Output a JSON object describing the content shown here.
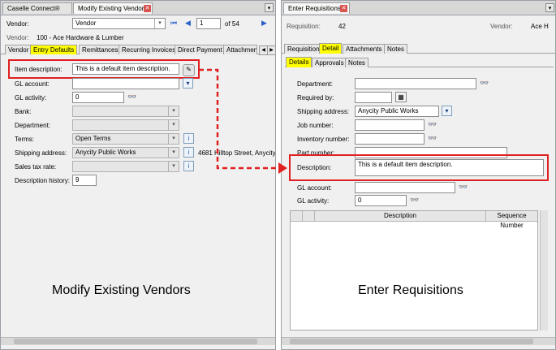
{
  "left": {
    "tabs": [
      {
        "label": "Caselle Connect®"
      },
      {
        "label": "Modify Existing Vendors"
      }
    ],
    "vendor_label": "Vendor:",
    "vendor_search_value": "Vendor",
    "record_number": "1",
    "record_total": "of 54",
    "vendor_info_label": "Vendor:",
    "vendor_info_value": "100  -  Ace Hardware & Lumber",
    "sub_tabs": [
      "Vendor",
      "Entry Defaults",
      "Remittances",
      "Recurring Invoices",
      "Direct Payment",
      "Attachmen"
    ],
    "form": {
      "item_description_label": "Item description:",
      "item_description_value": "This is a default item description.",
      "gl_account_label": "GL account:",
      "gl_activity_label": "GL activity:",
      "gl_activity_value": "0",
      "bank_label": "Bank:",
      "department_label": "Department:",
      "terms_label": "Terms:",
      "terms_value": "Open Terms",
      "shipping_address_label": "Shipping address:",
      "shipping_address_value": "Anycity Public Works",
      "shipping_address_extra": "4681 Hilltop Street, Anycity",
      "sales_tax_rate_label": "Sales tax rate:",
      "description_history_label": "Description history:",
      "description_history_value": "9"
    },
    "caption": "Modify Existing Vendors"
  },
  "right": {
    "tabs": [
      {
        "label": "Enter Requisitions"
      }
    ],
    "requisition_label": "Requisition:",
    "requisition_value": "42",
    "vendor_label": "Vendor:",
    "vendor_value": "Ace H",
    "main_tabs": [
      "Requisition",
      "Detail",
      "Attachments",
      "Notes"
    ],
    "sub_tabs": [
      "Details",
      "Approvals",
      "Notes"
    ],
    "form": {
      "department_label": "Department:",
      "required_by_label": "Required by:",
      "shipping_address_label": "Shipping address:",
      "shipping_address_value": "Anycity Public Works",
      "job_number_label": "Job number:",
      "inventory_number_label": "Inventory number:",
      "part_number_label": "Part number:",
      "description_label": "Description:",
      "description_value": "This is a default item description.",
      "gl_account_label": "GL account:",
      "gl_activity_label": "GL activity:",
      "gl_activity_value": "0"
    },
    "grid_columns": [
      "",
      "",
      "Description",
      "Sequence Number"
    ],
    "caption": "Enter Requisitions"
  },
  "colors": {
    "highlight": "#ffff00",
    "callout_red": "#e02020",
    "tab_strip": "#d7d7d7",
    "panel_bg": "#f0f0f0"
  },
  "icons": {
    "close": "close-icon",
    "dropdown": "chevron-down-icon",
    "first": "first-record-icon",
    "prev": "prev-record-icon",
    "next": "next-record-icon",
    "lookup": "binoculars-icon",
    "calendar": "calendar-icon",
    "info": "info-icon",
    "edit": "edit-icon"
  }
}
